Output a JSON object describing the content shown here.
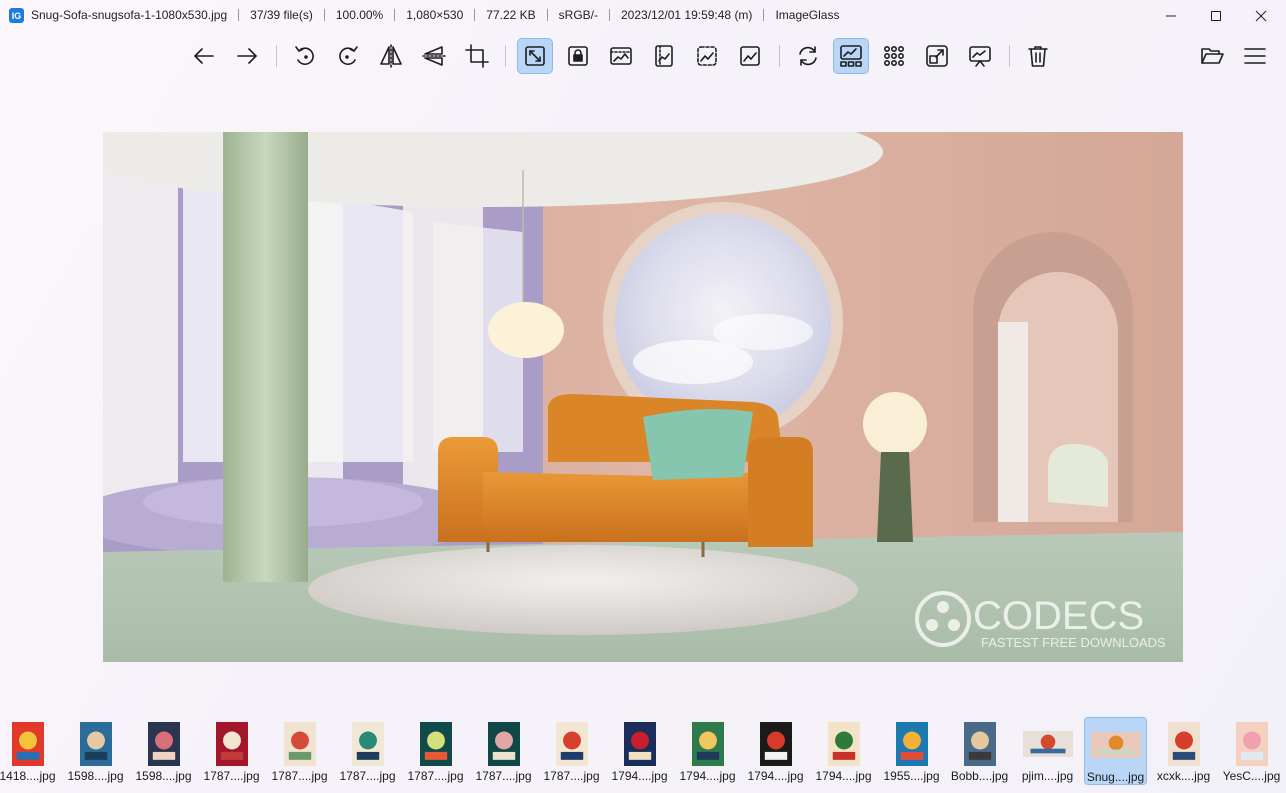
{
  "titlebar": {
    "segments": [
      "Snug-Sofa-snugsofa-1-1080x530.jpg",
      "37/39 file(s)",
      "100.00%",
      "1,080×530",
      "77.22 KB",
      "sRGB/-",
      "2023/12/01 19:59:48 (m)",
      "ImageGlass"
    ]
  },
  "toolbar": {
    "buttons": [
      {
        "name": "back-arrow-icon"
      },
      {
        "name": "forward-arrow-icon"
      },
      {
        "name": "rotate-left-icon"
      },
      {
        "name": "rotate-right-icon"
      },
      {
        "name": "flip-horizontal-icon"
      },
      {
        "name": "flip-vertical-icon"
      },
      {
        "name": "crop-icon"
      },
      {
        "name": "auto-zoom-icon",
        "active": true
      },
      {
        "name": "lock-zoom-icon"
      },
      {
        "name": "scale-to-width-icon"
      },
      {
        "name": "scale-to-height-icon"
      },
      {
        "name": "scale-to-fit-icon"
      },
      {
        "name": "scale-to-fill-icon"
      },
      {
        "name": "refresh-icon"
      },
      {
        "name": "gallery-icon",
        "active": true
      },
      {
        "name": "checkerboard-grid-icon"
      },
      {
        "name": "open-external-icon"
      },
      {
        "name": "slideshow-icon"
      },
      {
        "name": "trash-icon"
      },
      {
        "name": "open-folder-icon"
      },
      {
        "name": "menu-icon"
      }
    ]
  },
  "thumbnails": [
    {
      "label": "1418....jpg",
      "colors": [
        "#e23a2a",
        "#f3c43a",
        "#2a6fb6"
      ]
    },
    {
      "label": "1598....jpg",
      "colors": [
        "#2b6c9a",
        "#e8c8a0",
        "#1c3d5a"
      ]
    },
    {
      "label": "1598....jpg",
      "colors": [
        "#2a3550",
        "#d86f7a",
        "#f0d2c0"
      ]
    },
    {
      "label": "1787....jpg",
      "colors": [
        "#a3162b",
        "#f2e6d0",
        "#c43a3a"
      ]
    },
    {
      "label": "1787....jpg",
      "colors": [
        "#f1e3cf",
        "#d44b3a",
        "#6a9a6a"
      ]
    },
    {
      "label": "1787....jpg",
      "colors": [
        "#efe8d6",
        "#2a8a7a",
        "#1e3c5a"
      ]
    },
    {
      "label": "1787....jpg",
      "colors": [
        "#114a4a",
        "#d4e07a",
        "#e65a3a"
      ]
    },
    {
      "label": "1787....jpg",
      "colors": [
        "#0f4848",
        "#e3a6a6",
        "#f0e0d0"
      ]
    },
    {
      "label": "1787....jpg",
      "colors": [
        "#f3e6d2",
        "#d7402c",
        "#1f3d6a"
      ]
    },
    {
      "label": "1794....jpg",
      "colors": [
        "#1a2e5a",
        "#c81e2e",
        "#f0e0c0"
      ]
    },
    {
      "label": "1794....jpg",
      "colors": [
        "#2f7a4a",
        "#f0c860",
        "#1e3a5a"
      ]
    },
    {
      "label": "1794....jpg",
      "colors": [
        "#1a1a1a",
        "#d63a2a",
        "#f2f2f2"
      ]
    },
    {
      "label": "1794....jpg",
      "colors": [
        "#f2e2c8",
        "#2e7a3a",
        "#c8302a"
      ]
    },
    {
      "label": "1955....jpg",
      "colors": [
        "#1c7ab0",
        "#f2b23a",
        "#e24a3a"
      ]
    },
    {
      "label": "Bobb....jpg",
      "colors": [
        "#4a6a8a",
        "#e6c8a0",
        "#3a3a3a"
      ]
    },
    {
      "label": "pjim....jpg",
      "colors": [
        "#e8e0d8",
        "#d44a2a",
        "#3a6aa0"
      ]
    },
    {
      "label": "Snug....jpg",
      "colors": [
        "#e8c8b8",
        "#e08a2a",
        "#c8d8c8"
      ],
      "active": true
    },
    {
      "label": "xcxk....jpg",
      "colors": [
        "#f0e0d0",
        "#d4402a",
        "#2a4a7a"
      ]
    },
    {
      "label": "YesC....jpg",
      "colors": [
        "#f4d0c0",
        "#f0a0b0",
        "#e0e8f0"
      ]
    }
  ],
  "image": {
    "watermark_brand": "CODECS",
    "watermark_tagline": "FASTEST FREE DOWNLOADS"
  },
  "colors": {
    "accent_active": "#b9d6f6",
    "sofa": "#e08a2a",
    "wall": "#dcb2a2"
  }
}
